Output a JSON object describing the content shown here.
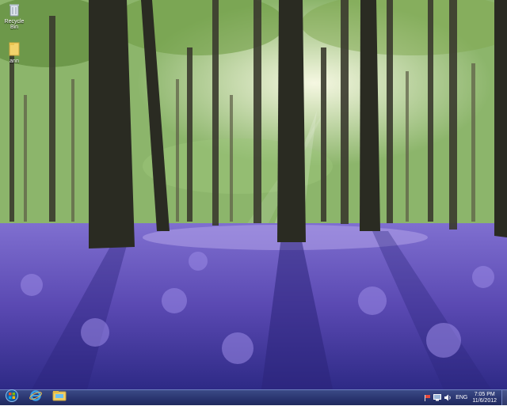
{
  "desktop": {
    "icons": [
      {
        "label": "Recycle Bin",
        "icon": "recycle-bin-icon"
      },
      {
        "label": "ann",
        "icon": "folder-icon"
      }
    ]
  },
  "taskbar": {
    "start_icon": "windows-start-icon",
    "pinned": [
      {
        "name": "Internet Explorer",
        "icon": "internet-explorer-icon"
      },
      {
        "name": "File Explorer",
        "icon": "folder-icon"
      }
    ],
    "tray": {
      "language": "ENG",
      "time": "7:05 PM",
      "date": "11/6/2012"
    }
  }
}
